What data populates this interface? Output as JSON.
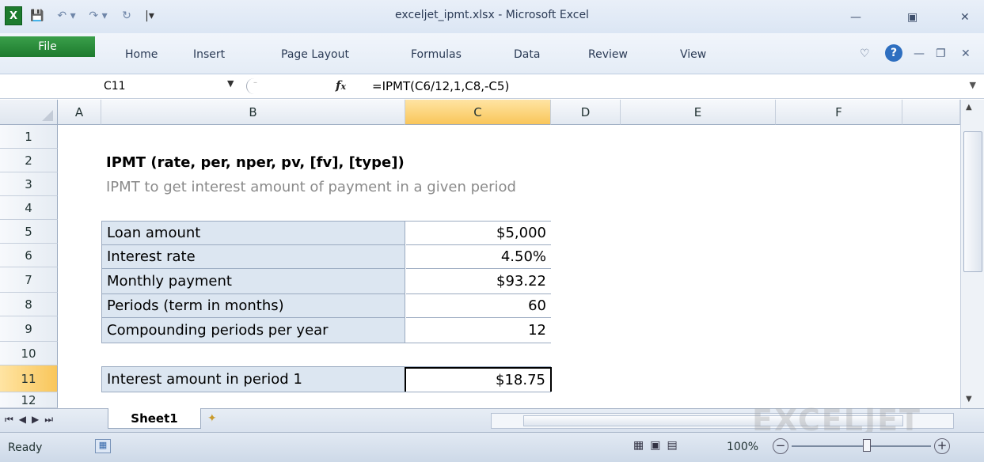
{
  "window": {
    "title": "exceljet_ipmt.xlsx - Microsoft Excel",
    "minimize_icon": "minimize-icon",
    "maximize_icon": "maximize-icon",
    "close_icon": "close-icon"
  },
  "ribbon": {
    "file": "File",
    "tabs": [
      "Home",
      "Insert",
      "Page Layout",
      "Formulas",
      "Data",
      "Review",
      "View"
    ]
  },
  "formula_bar": {
    "name_box": "C11",
    "fx": "fx",
    "formula": "=IPMT(C6/12,1,C8,-C5)"
  },
  "grid": {
    "columns": [
      "A",
      "B",
      "C",
      "D",
      "E",
      "F"
    ],
    "rows": [
      "1",
      "2",
      "3",
      "4",
      "5",
      "6",
      "7",
      "8",
      "9",
      "10",
      "11",
      "12"
    ],
    "selected_column": "C",
    "selected_row": "11",
    "heading": "IPMT (rate, per, nper, pv, [fv], [type])",
    "subheading": "IPMT to get interest amount of payment in a given period",
    "inputs": [
      {
        "label": "Loan amount",
        "value": "$5,000"
      },
      {
        "label": "Interest rate",
        "value": "4.50%"
      },
      {
        "label": "Monthly payment",
        "value": "$93.22"
      },
      {
        "label": "Periods (term in months)",
        "value": "60"
      },
      {
        "label": "Compounding periods per year",
        "value": "12"
      }
    ],
    "result": {
      "label": "Interest amount in period 1",
      "value": "$18.75"
    }
  },
  "sheets": {
    "active": "Sheet1"
  },
  "watermark": "EXCELJET",
  "status": {
    "ready": "Ready",
    "zoom": "100%"
  },
  "colors": {
    "label_fill": "#dce6f1",
    "header_selected": "#f9c65a",
    "file_tab": "#1d7b2e"
  }
}
